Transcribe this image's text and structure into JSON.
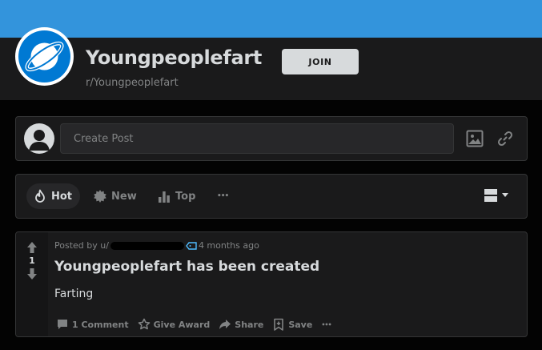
{
  "header": {
    "subreddit_title": "Youngpeoplefart",
    "subreddit_name": "r/Youngpeoplefart",
    "join_label": "JOIN"
  },
  "create_post": {
    "placeholder": "Create Post"
  },
  "sort": {
    "items": [
      {
        "label": "Hot",
        "icon": "flame-icon",
        "active": true
      },
      {
        "label": "New",
        "icon": "new-icon",
        "active": false
      },
      {
        "label": "Top",
        "icon": "top-icon",
        "active": false
      }
    ],
    "more": "•••"
  },
  "post": {
    "posted_by_prefix": "Posted by u/",
    "time_ago": "4 months ago",
    "votes": "1",
    "title": "Youngpeoplefart has been created",
    "body": "Farting",
    "actions": {
      "comments": "1 Comment",
      "award": "Give Award",
      "share": "Share",
      "save": "Save",
      "more": "•••"
    }
  },
  "colors": {
    "banner": "#3394dc",
    "page_bg": "#030303",
    "card_bg": "#1a1a1b",
    "border": "#343536",
    "text_primary": "#d7dadc",
    "text_muted": "#818384",
    "community_icon": "#0079d3"
  }
}
